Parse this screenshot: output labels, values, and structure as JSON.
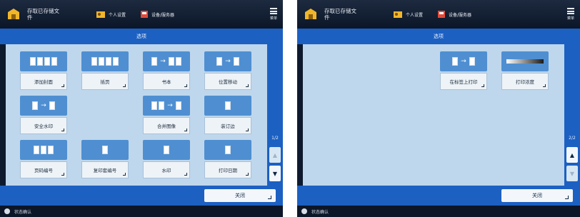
{
  "screens": [
    {
      "topbar": {
        "home_label": "存取已存储文件",
        "user_label": "个人设置",
        "device_label": "设备/服务器",
        "menu_label": "菜单"
      },
      "title": "选项",
      "page_indicator": "1/2",
      "tiles": [
        {
          "label": "添加封面"
        },
        {
          "label": "插页"
        },
        {
          "label": "书本"
        },
        {
          "label": "位置移动"
        },
        {
          "label": "安全水印"
        },
        {
          "label": "合并图像"
        },
        {
          "label": "装订边"
        },
        {
          "label": "页码编号"
        },
        {
          "label": "复印套编号"
        },
        {
          "label": "水印"
        },
        {
          "label": "打印日期"
        }
      ],
      "close_label": "关闭",
      "status_text": "状态确认"
    },
    {
      "topbar": {
        "home_label": "存取已存储文件",
        "user_label": "个人设置",
        "device_label": "设备/服务器",
        "menu_label": "菜单"
      },
      "title": "选项",
      "page_indicator": "2/2",
      "tiles": [
        {
          "label": "在标签上打印"
        },
        {
          "label": "打印浓度"
        }
      ],
      "close_label": "关闭",
      "status_text": "状态确认"
    }
  ],
  "icons": {
    "home": "home-folder-icon",
    "user": "personal-settings-icon",
    "device": "device-icon",
    "menu": "menu-icon",
    "scroll_up": "▲",
    "scroll_down": "▼",
    "arrow": "→"
  },
  "colors": {
    "accent_blue": "#1c60c2",
    "content_bg": "#bfd7ec",
    "topbar_bg": "#0b1628",
    "tile_image": "#4f8fd1"
  }
}
